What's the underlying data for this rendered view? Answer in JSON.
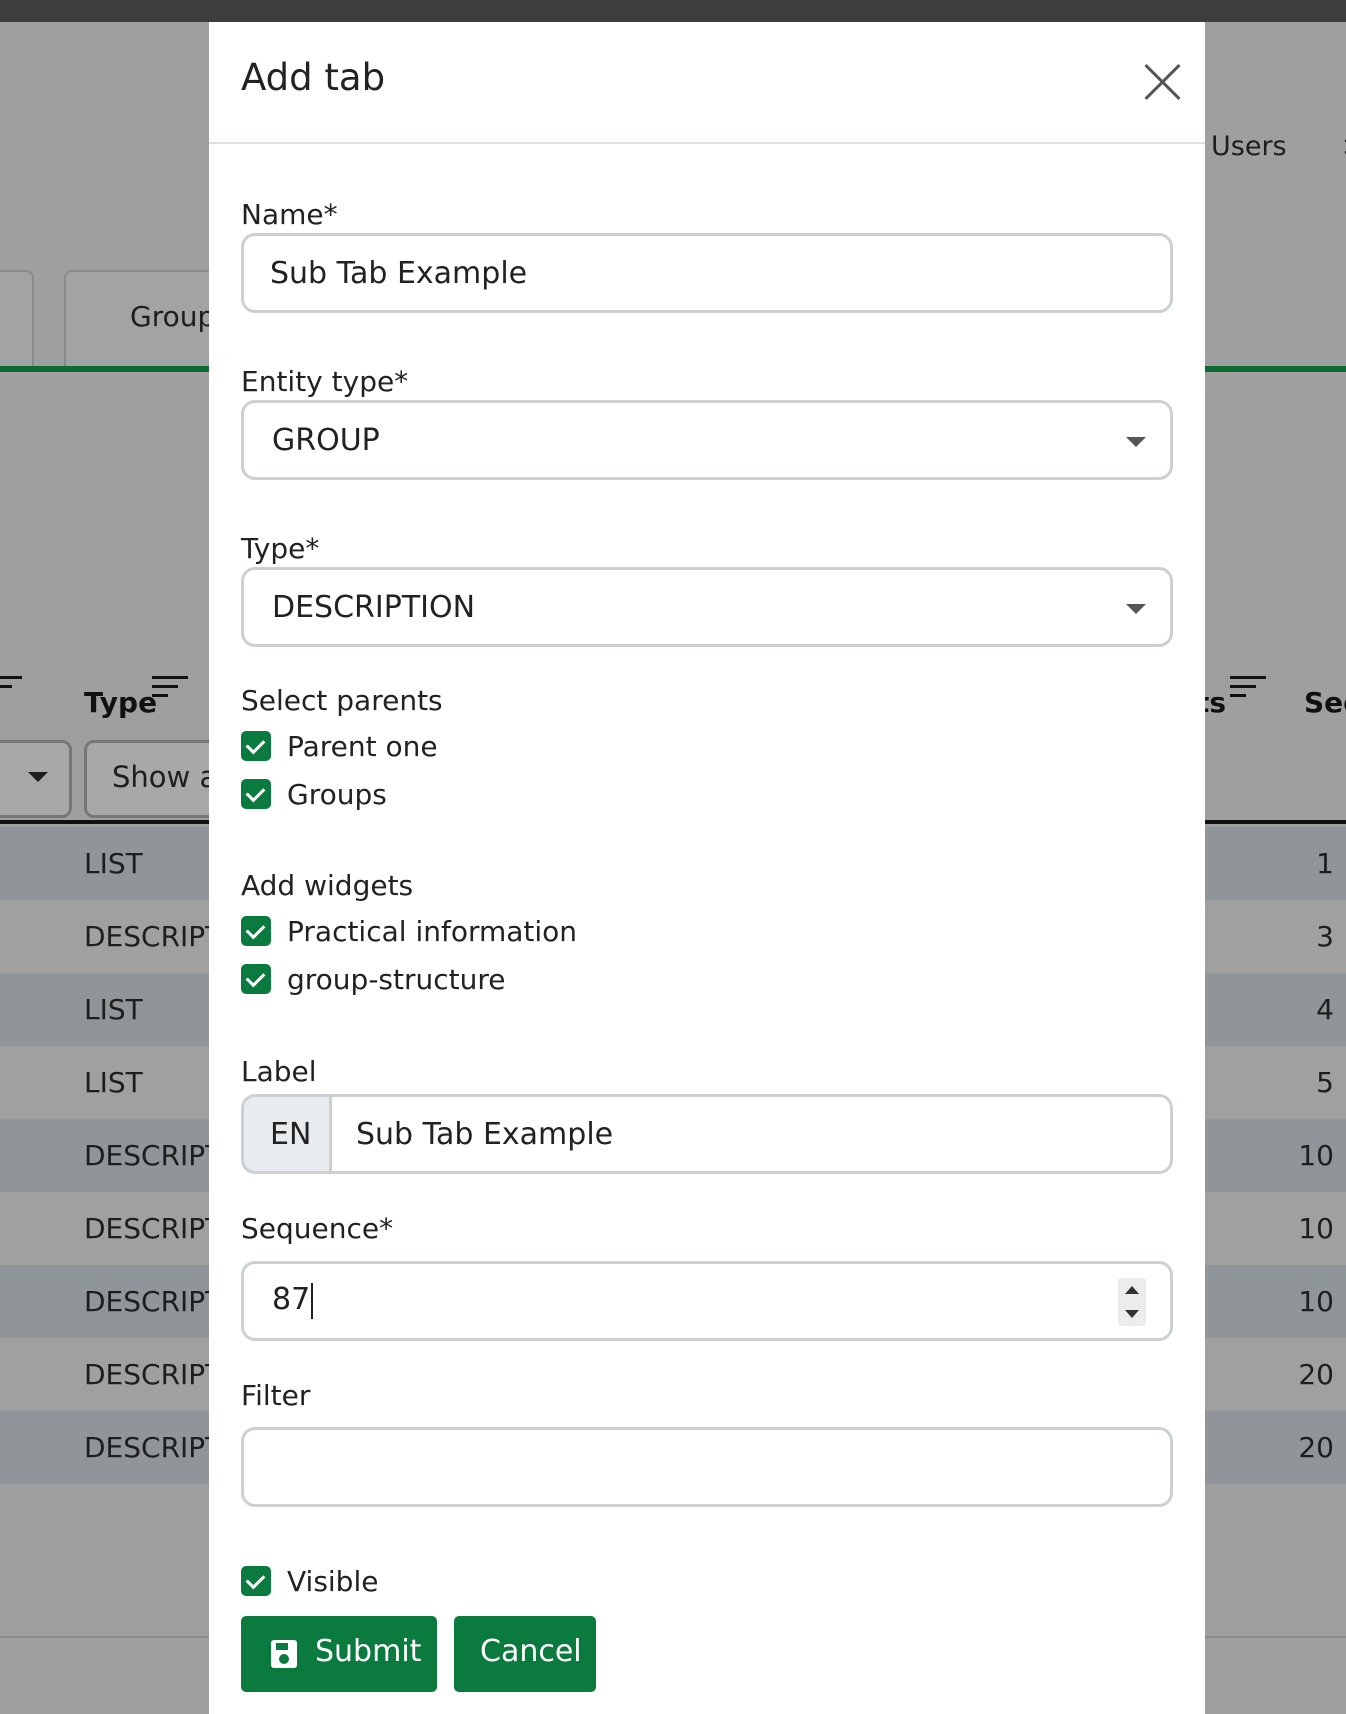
{
  "background": {
    "nav_users": "Users",
    "nav_more": ">",
    "tab_label": "Group",
    "col_type": "Type",
    "col_ts": "ts",
    "col_sec": "Sec",
    "filter_show": "Show a",
    "rows": [
      {
        "type": "LIST",
        "seq": "1"
      },
      {
        "type": "DESCRIPT",
        "seq": "3"
      },
      {
        "type": "LIST",
        "seq": "4"
      },
      {
        "type": "LIST",
        "seq": "5"
      },
      {
        "type": "DESCRIPT",
        "seq": "10"
      },
      {
        "type": "DESCRIPT",
        "seq": "10"
      },
      {
        "type": "DESCRIPT",
        "seq": "10"
      },
      {
        "type": "DESCRIPT",
        "seq": "20"
      },
      {
        "type": "DESCRIPT",
        "seq": "20"
      }
    ]
  },
  "modal": {
    "title": "Add tab",
    "name_label": "Name*",
    "name_value": "Sub Tab Example",
    "entity_type_label": "Entity type*",
    "entity_type_value": "GROUP",
    "type_label": "Type*",
    "type_value": "DESCRIPTION",
    "parents_label": "Select parents",
    "parents": [
      "Parent one",
      "Groups"
    ],
    "widgets_label": "Add widgets",
    "widgets": [
      "Practical information",
      "group-structure"
    ],
    "label_label": "Label",
    "label_lang": "EN",
    "label_value": "Sub Tab Example",
    "sequence_label": "Sequence*",
    "sequence_value": "87",
    "filter_label": "Filter",
    "filter_value": "",
    "visible_label": "Visible",
    "submit_label": "Submit",
    "cancel_label": "Cancel"
  },
  "colors": {
    "primary": "#0b7a3e",
    "topbar": "#3d3d3d",
    "backdrop": "#9f9f9f"
  }
}
